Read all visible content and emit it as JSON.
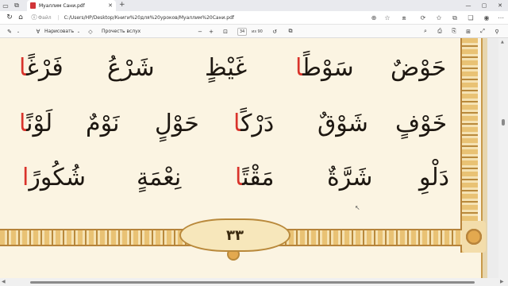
{
  "tab": {
    "title": "Муаллим Сани.pdf",
    "close": "✕",
    "new": "+"
  },
  "window": {
    "minimize": "—",
    "maximize": "▢",
    "close": "✕"
  },
  "address": {
    "file_label": "Файл",
    "url": "C:/Users/HP/Desktop/Книги%20для%20уроков/Муаллим%20Сани.pdf"
  },
  "toolbar": {
    "draw_label": "Нарисовать",
    "read_aloud_label": "Прочесть вслух",
    "page_current": "34",
    "page_of": "из 90",
    "zoom_out": "−",
    "zoom_in": "+"
  },
  "page": {
    "page_number": "٣٣",
    "rows": [
      [
        {
          "parts": [
            {
              "t": "حَوْضٌ",
              "r": false
            }
          ]
        },
        {
          "parts": [
            {
              "t": "سَوْطً",
              "r": false
            },
            {
              "t": "ا",
              "r": true
            }
          ]
        },
        {
          "parts": [
            {
              "t": "غَيْظٍ",
              "r": false
            }
          ]
        },
        {
          "parts": [
            {
              "t": "شَرْعُ",
              "r": false
            }
          ]
        },
        {
          "parts": [
            {
              "t": "فَرْغً",
              "r": false
            },
            {
              "t": "ا",
              "r": true
            }
          ]
        }
      ],
      [
        {
          "parts": [
            {
              "t": "خَوْفٍ",
              "r": false
            }
          ]
        },
        {
          "parts": [
            {
              "t": "شَوْقٌ",
              "r": false
            }
          ]
        },
        {
          "parts": [
            {
              "t": "دَرْكً",
              "r": false
            },
            {
              "t": "ا",
              "r": true
            }
          ]
        },
        {
          "parts": [
            {
              "t": "حَوْلٍ",
              "r": false
            }
          ]
        },
        {
          "parts": [
            {
              "t": "نَوْمٌ",
              "r": false
            }
          ]
        },
        {
          "parts": [
            {
              "t": "لَوْنً",
              "r": false
            },
            {
              "t": "ا",
              "r": true
            }
          ]
        }
      ],
      [
        {
          "parts": [
            {
              "t": "دَلْوِ",
              "r": false
            }
          ]
        },
        {
          "parts": [
            {
              "t": "شَرَّةٌ",
              "r": false
            }
          ]
        },
        {
          "parts": [
            {
              "t": "مَقْتً",
              "r": false
            },
            {
              "t": "ا",
              "r": true
            }
          ]
        },
        {
          "parts": [
            {
              "t": "نِعْمَةٍ",
              "r": false
            }
          ]
        },
        {
          "parts": [
            {
              "t": "شُكُورً",
              "r": false
            },
            {
              "t": "ا",
              "r": true
            }
          ]
        }
      ]
    ]
  }
}
